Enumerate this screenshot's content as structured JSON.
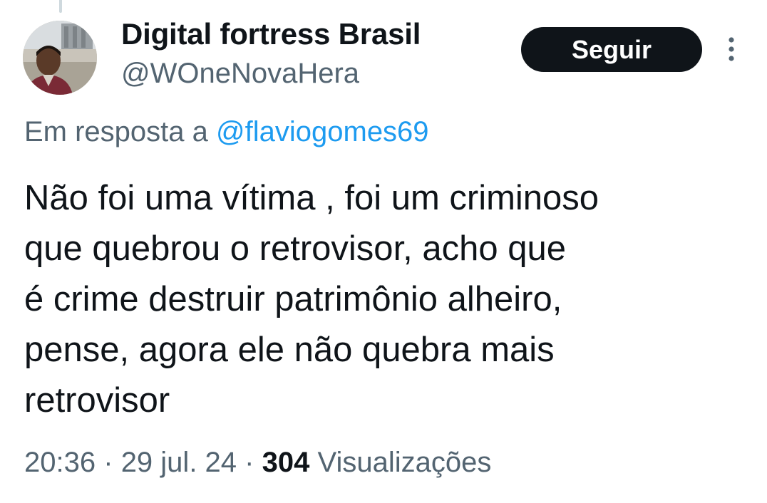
{
  "author": {
    "display_name": "Digital fortress Brasil",
    "handle": "@WOneNovaHera"
  },
  "header": {
    "follow_label": "Seguir",
    "more_icon": "more-vertical-icon"
  },
  "reply": {
    "prefix": "Em resposta a",
    "mention": "@flaviogomes69"
  },
  "tweet": {
    "lines": [
      "Não foi uma vítima , foi um criminoso",
      "que quebrou o retrovisor, acho que",
      "é crime destruir patrimônio alheiro,",
      "pense, agora ele não quebra mais",
      "retrovisor"
    ]
  },
  "meta": {
    "time": "20:36",
    "separator": "·",
    "date": "29 jul. 24",
    "views_count": "304",
    "views_label": "Visualizações"
  },
  "colors": {
    "text_primary": "#0f1419",
    "text_secondary": "#536471",
    "link": "#1d9bf0",
    "button_bg": "#0f1419"
  }
}
